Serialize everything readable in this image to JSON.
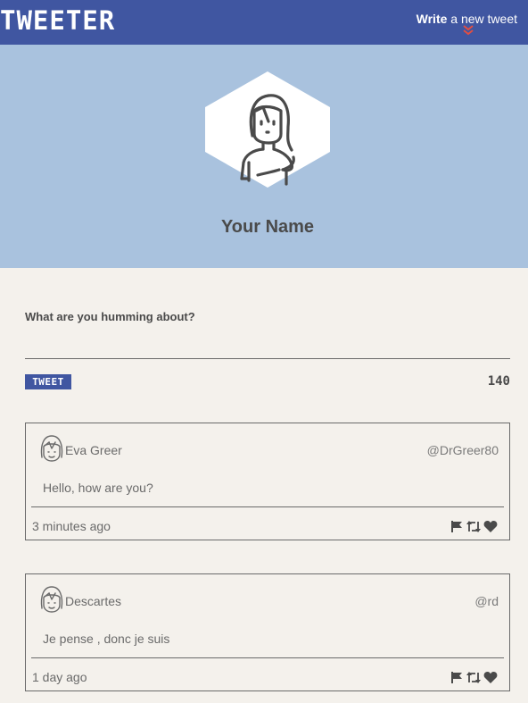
{
  "nav": {
    "logo": "TWEETER",
    "compose_bold": "Write",
    "compose_rest": " a new tweet"
  },
  "profile": {
    "name": "Your Name"
  },
  "composer": {
    "label": "What are you humming about?",
    "placeholder": "",
    "button_label": "TWEET",
    "counter": "140"
  },
  "tweets": [
    {
      "name": "Eva Greer",
      "handle": "@DrGreer80",
      "text": "Hello, how are you?",
      "time": "3 minutes ago"
    },
    {
      "name": "Descartes",
      "handle": "@rd",
      "text": "Je pense , donc je suis",
      "time": "1 day ago"
    }
  ],
  "icons": {
    "flag": "flag-icon",
    "retweet": "retweet-icon",
    "like": "heart-icon"
  },
  "colors": {
    "nav": "#4056a1",
    "header": "#a9c2de",
    "page": "#f4f1ec",
    "accent": "#e24e42"
  }
}
